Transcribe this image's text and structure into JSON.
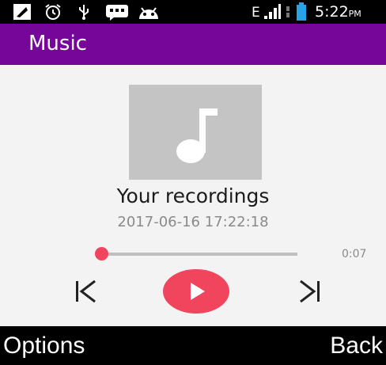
{
  "status_bar": {
    "network": "E",
    "time": "5:22",
    "ampm": "PM",
    "icons": [
      "notification-icon",
      "alarm-icon",
      "usb-icon",
      "bbm-icon",
      "android-icon",
      "signal-icon",
      "data-arrows-icon",
      "battery-icon"
    ]
  },
  "app_bar": {
    "title": "Music"
  },
  "player": {
    "album_art_icon": "music-note-icon",
    "track_title": "Your recordings",
    "track_date": "2017-06-16 17:22:18",
    "elapsed_time": "0:07",
    "progress_fraction": 0.0,
    "controls": [
      "previous-icon",
      "play-icon",
      "next-icon"
    ]
  },
  "softkeys": {
    "left": "Options",
    "right": "Back"
  },
  "colors": {
    "app_bar": "#76069a",
    "accent": "#f1455e",
    "album_bg": "#c4c4c4",
    "background": "#f3f3f3"
  }
}
